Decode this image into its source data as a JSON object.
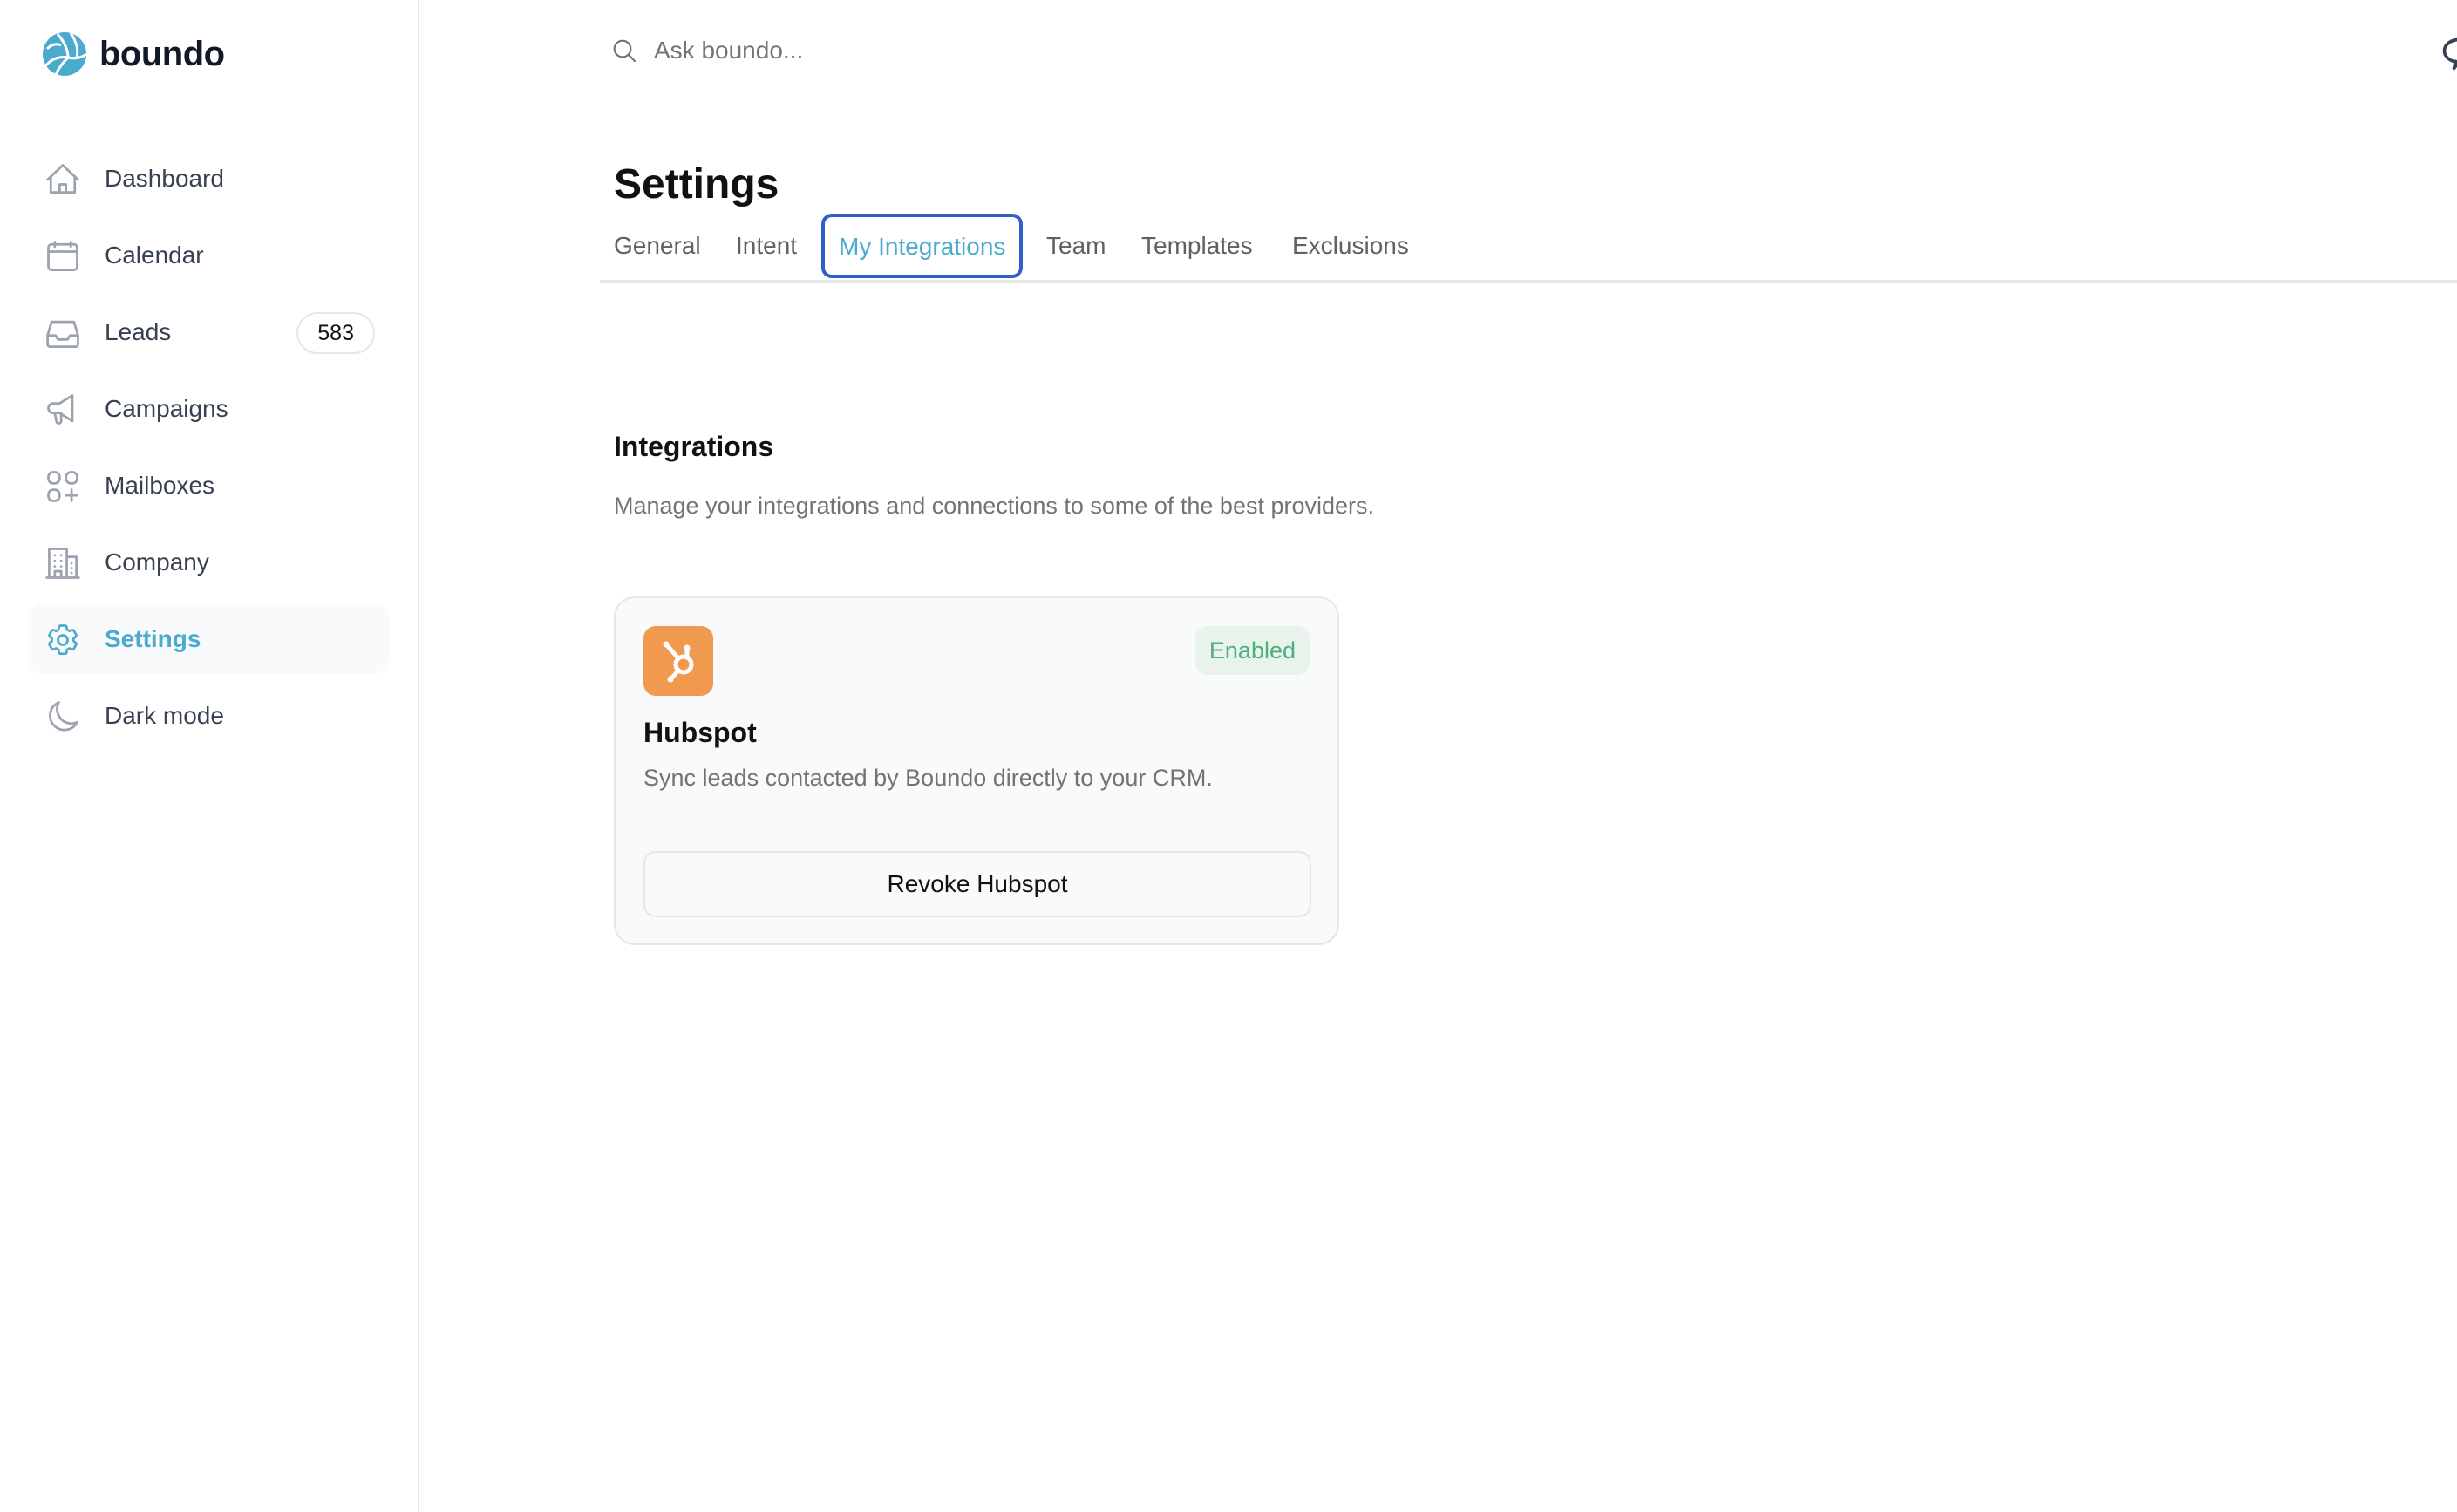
{
  "brand": {
    "name": "boundo",
    "color": "#4aabcf"
  },
  "sidebar": {
    "items": [
      {
        "label": "Dashboard",
        "icon": "home-icon"
      },
      {
        "label": "Calendar",
        "icon": "calendar-icon"
      },
      {
        "label": "Leads",
        "icon": "inbox-icon",
        "badge": "583"
      },
      {
        "label": "Campaigns",
        "icon": "megaphone-icon"
      },
      {
        "label": "Mailboxes",
        "icon": "grid-plus-icon"
      },
      {
        "label": "Company",
        "icon": "building-icon"
      },
      {
        "label": "Settings",
        "icon": "gear-icon",
        "active": true
      },
      {
        "label": "Dark mode",
        "icon": "moon-icon"
      }
    ]
  },
  "search": {
    "placeholder": "Ask boundo...",
    "value": ""
  },
  "page": {
    "title": "Settings",
    "tabs": [
      {
        "label": "General"
      },
      {
        "label": "Intent"
      },
      {
        "label": "My Integrations",
        "active": true
      },
      {
        "label": "Team"
      },
      {
        "label": "Templates"
      },
      {
        "label": "Exclusions"
      }
    ]
  },
  "integrations": {
    "title": "Integrations",
    "description": "Manage your integrations and connections to some of the best providers.",
    "cards": [
      {
        "name": "Hubspot",
        "icon": "hubspot-logo-icon",
        "status": "Enabled",
        "description": "Sync leads contacted by Boundo directly to your CRM.",
        "action_label": "Revoke Hubspot",
        "logo_color": "#f0994f",
        "status_color": "#4fae7d"
      }
    ]
  },
  "colors": {
    "accent": "#4aabcf",
    "focus_ring": "#2f5fc9",
    "muted_text": "#737373",
    "border": "#e5e7eb"
  }
}
